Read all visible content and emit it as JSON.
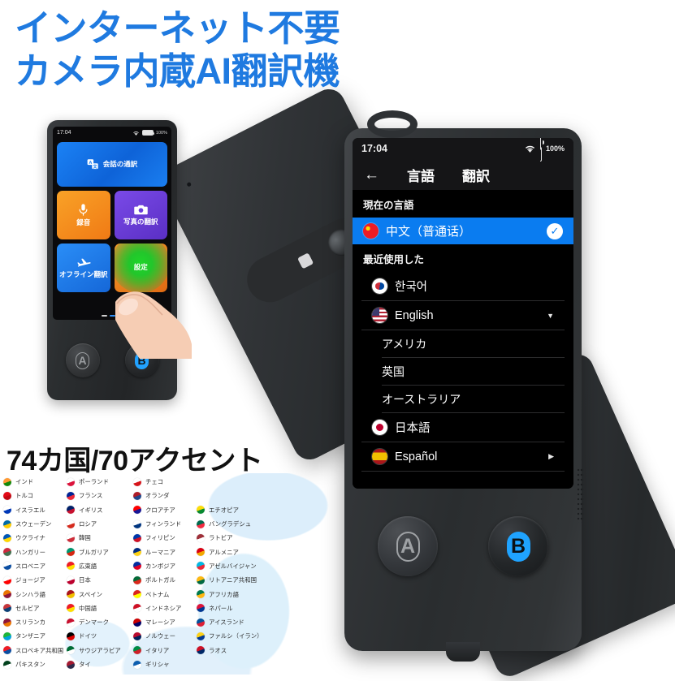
{
  "headline": {
    "line1": "インターネット不要",
    "line2": "カメラ内蔵AI翻訳機",
    "color": "#1f7ae0"
  },
  "small_device": {
    "status_bar": {
      "time": "17:04",
      "wifi_icon": "wifi-icon",
      "battery_pct": "100%"
    },
    "tiles": [
      {
        "label": "会話の通訳",
        "icon": "translate-icon",
        "color": "#1b82f5"
      },
      {
        "label": "録音",
        "icon": "microphone-icon",
        "color": "#f0922a"
      },
      {
        "label": "写真の翻訳",
        "icon": "camera-icon",
        "color": "#6a3cdc"
      },
      {
        "label": "オフライン翻訳",
        "icon": "airplane-icon",
        "color": "#2a8ef7"
      },
      {
        "label": "設定",
        "icon": "gear-icon",
        "color": "#e87a16"
      }
    ],
    "page_dots": 3,
    "active_dot": 2,
    "button_a": "A",
    "button_b": "B"
  },
  "main_device": {
    "status_bar": {
      "time": "17:04",
      "wifi_icon": "wifi-icon",
      "battery_pct": "100%"
    },
    "nav": {
      "back_icon": "arrow-left-icon",
      "tab_language": "言語",
      "tab_translate": "翻訳"
    },
    "section_current": "現在の言語",
    "current_language": {
      "name": "中文（普通话）",
      "flag": "cn",
      "selected": true,
      "check_icon": "check-icon"
    },
    "section_recent": "最近使用した",
    "languages": [
      {
        "name": "한국어",
        "flag": "kr",
        "expandable": false
      },
      {
        "name": "English",
        "flag": "us",
        "expandable": true,
        "expanded": true,
        "sub": [
          "アメリカ",
          "英国",
          "オーストラリア"
        ]
      },
      {
        "name": "日本語",
        "flag": "jp",
        "expandable": false
      },
      {
        "name": "Español",
        "flag": "es",
        "expandable": true,
        "expanded": false
      }
    ],
    "button_a": "A",
    "button_b": "B",
    "accent_color": "#0a7cf0"
  },
  "countries": {
    "title": "74カ国/70アクセント",
    "columns": [
      [
        {
          "name": "インド",
          "c1": "#ff9933",
          "c2": "#138808"
        },
        {
          "name": "トルコ",
          "c1": "#e30a17",
          "c2": "#c00812"
        },
        {
          "name": "イスラエル",
          "c1": "#ffffff",
          "c2": "#0038b8"
        },
        {
          "name": "スウェーデン",
          "c1": "#006aa7",
          "c2": "#fecc00"
        },
        {
          "name": "ウクライナ",
          "c1": "#0057b7",
          "c2": "#ffd700"
        },
        {
          "name": "ハンガリー",
          "c1": "#cd2a3e",
          "c2": "#436f4d"
        },
        {
          "name": "スロベニア",
          "c1": "#ffffff",
          "c2": "#0b4ea2"
        },
        {
          "name": "ジョージア",
          "c1": "#ffffff",
          "c2": "#ff0000"
        },
        {
          "name": "シンハラ語",
          "c1": "#eb7400",
          "c2": "#8d153a"
        },
        {
          "name": "セルビア",
          "c1": "#c6363c",
          "c2": "#0c4076"
        },
        {
          "name": "スリランカ",
          "c1": "#8d153a",
          "c2": "#eb7400"
        },
        {
          "name": "タンザニア",
          "c1": "#1eb53a",
          "c2": "#00a3dd"
        },
        {
          "name": "スロベキア共和国",
          "c1": "#ee1c25",
          "c2": "#0b4ea2"
        },
        {
          "name": "パキスタン",
          "c1": "#01411c",
          "c2": "#ffffff"
        }
      ],
      [
        {
          "name": "ポーランド",
          "c1": "#ffffff",
          "c2": "#dc143c"
        },
        {
          "name": "フランス",
          "c1": "#002395",
          "c2": "#ed2939"
        },
        {
          "name": "イギリス",
          "c1": "#012169",
          "c2": "#c8102e"
        },
        {
          "name": "ロシア",
          "c1": "#ffffff",
          "c2": "#d52b1e"
        },
        {
          "name": "韓国",
          "c1": "#ffffff",
          "c2": "#cd2e3a"
        },
        {
          "name": "ブルガリア",
          "c1": "#00966e",
          "c2": "#d62612"
        },
        {
          "name": "広東語",
          "c1": "#ee1c25",
          "c2": "#ffde00"
        },
        {
          "name": "日本",
          "c1": "#ffffff",
          "c2": "#bc002d"
        },
        {
          "name": "スペイン",
          "c1": "#aa151b",
          "c2": "#f1bf00"
        },
        {
          "name": "中国語",
          "c1": "#ee1c25",
          "c2": "#ffde00"
        },
        {
          "name": "デンマーク",
          "c1": "#c8102e",
          "c2": "#ffffff"
        },
        {
          "name": "ドイツ",
          "c1": "#000000",
          "c2": "#dd0000"
        },
        {
          "name": "サウジアラビア",
          "c1": "#006c35",
          "c2": "#ffffff"
        },
        {
          "name": "タイ",
          "c1": "#a51931",
          "c2": "#2d2a4a"
        }
      ],
      [
        {
          "name": "チェコ",
          "c1": "#ffffff",
          "c2": "#d7141a"
        },
        {
          "name": "オランダ",
          "c1": "#ae1c28",
          "c2": "#21468b"
        },
        {
          "name": "クロアチア",
          "c1": "#ff0000",
          "c2": "#171796"
        },
        {
          "name": "フィンランド",
          "c1": "#ffffff",
          "c2": "#003580"
        },
        {
          "name": "フィリピン",
          "c1": "#0038a8",
          "c2": "#ce1126"
        },
        {
          "name": "ルーマニア",
          "c1": "#002b7f",
          "c2": "#fcd116"
        },
        {
          "name": "カンボジア",
          "c1": "#032ea1",
          "c2": "#e00025"
        },
        {
          "name": "ポルトガル",
          "c1": "#046a38",
          "c2": "#da291c"
        },
        {
          "name": "ベトナム",
          "c1": "#da251d",
          "c2": "#ffff00"
        },
        {
          "name": "インドネシア",
          "c1": "#ce1126",
          "c2": "#ffffff"
        },
        {
          "name": "マレーシア",
          "c1": "#cc0001",
          "c2": "#010066"
        },
        {
          "name": "ノルウェー",
          "c1": "#ba0c2f",
          "c2": "#00205b"
        },
        {
          "name": "イタリア",
          "c1": "#008c45",
          "c2": "#cd212a"
        },
        {
          "name": "ギリシャ",
          "c1": "#0d5eaf",
          "c2": "#ffffff"
        }
      ],
      [
        {
          "name": "エチオピア",
          "c1": "#fcdd09",
          "c2": "#078930"
        },
        {
          "name": "バングラデシュ",
          "c1": "#006a4e",
          "c2": "#f42a41"
        },
        {
          "name": "ラトビア",
          "c1": "#9e3039",
          "c2": "#ffffff"
        },
        {
          "name": "アルメニア",
          "c1": "#d90012",
          "c2": "#f2a800"
        },
        {
          "name": "アゼルバイジャン",
          "c1": "#00b9e4",
          "c2": "#ed2939"
        },
        {
          "name": "リトアニア共和国",
          "c1": "#fdb913",
          "c2": "#006a44"
        },
        {
          "name": "アフリカ語",
          "c1": "#007a4d",
          "c2": "#ffb612"
        },
        {
          "name": "ネパール",
          "c1": "#dc143c",
          "c2": "#003893"
        },
        {
          "name": "アイスランド",
          "c1": "#02529c",
          "c2": "#dc1e35"
        },
        {
          "name": "ファルシ（イラン）",
          "c1": "#fcd116",
          "c2": "#003893"
        },
        {
          "name": "ラオス",
          "c1": "#ce1126",
          "c2": "#002868"
        }
      ]
    ]
  }
}
